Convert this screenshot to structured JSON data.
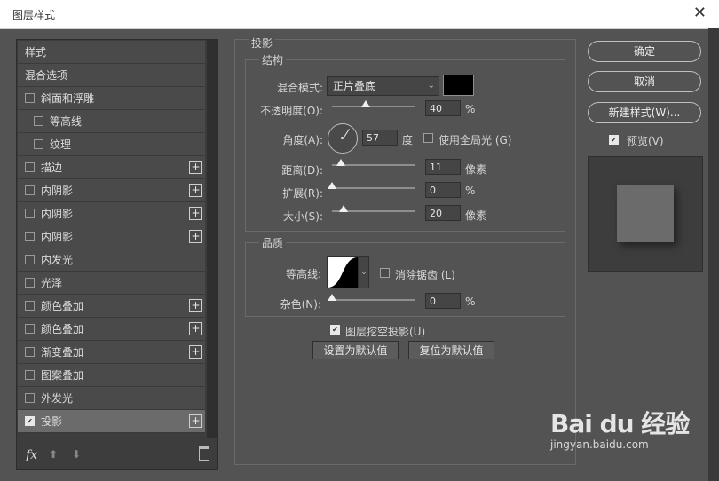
{
  "window": {
    "title": "图层样式"
  },
  "left": {
    "items": [
      {
        "label": "样式",
        "type": "header"
      },
      {
        "label": "混合选项",
        "type": "header"
      },
      {
        "label": "斜面和浮雕",
        "checked": false,
        "plus": false
      },
      {
        "label": "等高线",
        "checked": false,
        "plus": false,
        "indent": true
      },
      {
        "label": "纹理",
        "checked": false,
        "plus": false,
        "indent": true
      },
      {
        "label": "描边",
        "checked": false,
        "plus": true
      },
      {
        "label": "内阴影",
        "checked": false,
        "plus": true
      },
      {
        "label": "内阴影",
        "checked": false,
        "plus": true
      },
      {
        "label": "内阴影",
        "checked": false,
        "plus": true
      },
      {
        "label": "内发光",
        "checked": false,
        "plus": false
      },
      {
        "label": "光泽",
        "checked": false,
        "plus": false
      },
      {
        "label": "颜色叠加",
        "checked": false,
        "plus": true
      },
      {
        "label": "颜色叠加",
        "checked": false,
        "plus": true
      },
      {
        "label": "渐变叠加",
        "checked": false,
        "plus": true
      },
      {
        "label": "图案叠加",
        "checked": false,
        "plus": false
      },
      {
        "label": "外发光",
        "checked": false,
        "plus": false
      },
      {
        "label": "投影",
        "checked": true,
        "plus": true,
        "active": true
      }
    ],
    "fx": "fx",
    "plus_glyph": "+"
  },
  "main": {
    "title": "投影",
    "structure": {
      "title": "结构",
      "blend_label": "混合模式:",
      "blend_value": "正片叠底",
      "blend_color": "#000000",
      "opacity_label": "不透明度(O):",
      "opacity_value": "40",
      "opacity_unit": "%",
      "opacity_level": 0.4,
      "angle_label": "角度(A):",
      "angle_value": "57",
      "angle_unit": "度",
      "global_light_label": "使用全局光 (G)",
      "global_light_checked": false,
      "distance_label": "距离(D):",
      "distance_value": "11",
      "distance_unit": "像素",
      "spread_label": "扩展(R):",
      "spread_value": "0",
      "spread_unit": "%",
      "size_label": "大小(S):",
      "size_value": "20",
      "size_unit": "像素"
    },
    "quality": {
      "title": "品质",
      "contour_label": "等高线:",
      "antialias_label": "消除锯齿 (L)",
      "antialias_checked": false,
      "noise_label": "杂色(N):",
      "noise_value": "0",
      "noise_unit": "%"
    },
    "knockout_label": "图层挖空投影(U)",
    "knockout_checked": true,
    "set_default": "设置为默认值",
    "reset_default": "复位为默认值"
  },
  "right": {
    "ok": "确定",
    "cancel": "取消",
    "new_style": "新建样式(W)...",
    "preview_label": "预览(V)",
    "preview_checked": true
  },
  "watermark": {
    "brand": "Bai du 经验",
    "sub": "jingyan.baidu.com"
  },
  "icons": {
    "close": "close-icon",
    "fx": "fx-icon",
    "up": "arrow-up-icon",
    "down": "arrow-down-icon",
    "trash": "trash-icon",
    "plus": "plus-icon",
    "chevron": "chevron-down-icon"
  }
}
